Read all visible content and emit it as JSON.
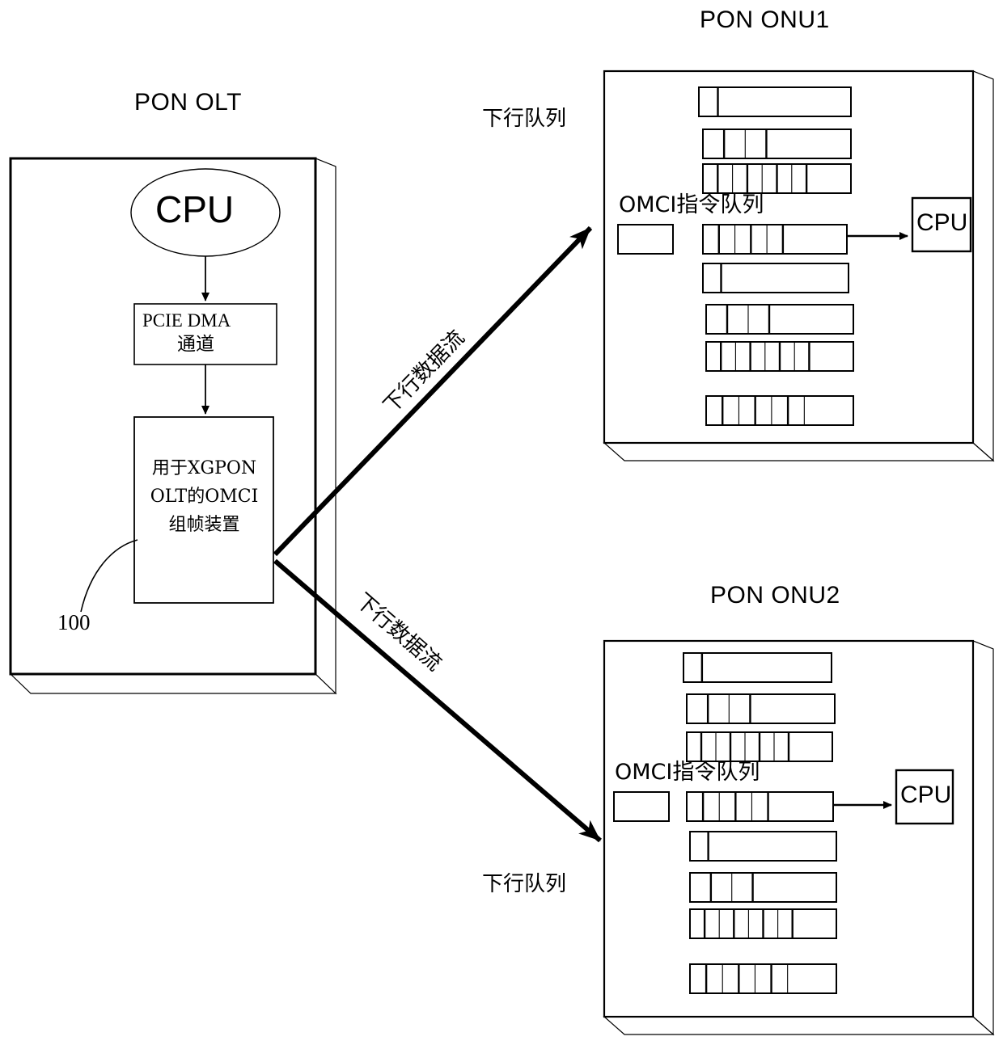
{
  "diagram": {
    "kind": "network-architecture-diagram",
    "background_color": "#ffffff",
    "line_color": "#000000",
    "olt": {
      "title": "PON OLT",
      "reference_numeral": "100",
      "cpu_label": "CPU",
      "dma_line1": "PCIE DMA",
      "dma_line2": "通道",
      "device_line1": "用于XGPON",
      "device_line2": "OLT的OMCI",
      "device_line3": "组帧装置"
    },
    "flows": [
      {
        "label": "下行数据流",
        "target": "PON ONU1"
      },
      {
        "label": "下行数据流",
        "target": "PON ONU2"
      }
    ],
    "onu1": {
      "title": "PON ONU1",
      "queue_group_label": "下行队列",
      "omci_queue_label": "OMCI指令队列",
      "cpu_label": "CPU",
      "queues": [
        {
          "name": "queue-1",
          "segments": [
            1,
            7
          ]
        },
        {
          "name": "queue-2",
          "segments": [
            1,
            1,
            1,
            4
          ]
        },
        {
          "name": "queue-3",
          "segments": [
            1,
            1,
            1,
            1,
            1,
            1,
            1,
            3
          ]
        },
        {
          "name": "omci-command-queue",
          "segments": [
            1,
            1,
            1,
            1,
            1,
            4
          ]
        },
        {
          "name": "queue-5",
          "segments": [
            1,
            7
          ]
        },
        {
          "name": "queue-6",
          "segments": [
            1,
            1,
            1,
            4
          ]
        },
        {
          "name": "queue-7",
          "segments": [
            1,
            1,
            1,
            1,
            1,
            1,
            1,
            3
          ]
        },
        {
          "name": "queue-8",
          "segments": [
            1,
            1,
            1,
            1,
            1,
            1,
            3
          ]
        }
      ]
    },
    "onu2": {
      "title": "PON ONU2",
      "queue_group_label": "下行队列",
      "omci_queue_label": "OMCI指令队列",
      "cpu_label": "CPU",
      "queues": [
        {
          "name": "queue-1",
          "segments": [
            1,
            7
          ]
        },
        {
          "name": "queue-2",
          "segments": [
            1,
            1,
            1,
            4
          ]
        },
        {
          "name": "queue-3",
          "segments": [
            1,
            1,
            1,
            1,
            1,
            1,
            1,
            3
          ]
        },
        {
          "name": "omci-command-queue",
          "segments": [
            1,
            1,
            1,
            1,
            1,
            4
          ]
        },
        {
          "name": "queue-5",
          "segments": [
            1,
            7
          ]
        },
        {
          "name": "queue-6",
          "segments": [
            1,
            1,
            1,
            4
          ]
        },
        {
          "name": "queue-7",
          "segments": [
            1,
            1,
            1,
            1,
            1,
            1,
            1,
            3
          ]
        },
        {
          "name": "queue-8",
          "segments": [
            1,
            1,
            1,
            1,
            1,
            1,
            3
          ]
        }
      ]
    }
  }
}
